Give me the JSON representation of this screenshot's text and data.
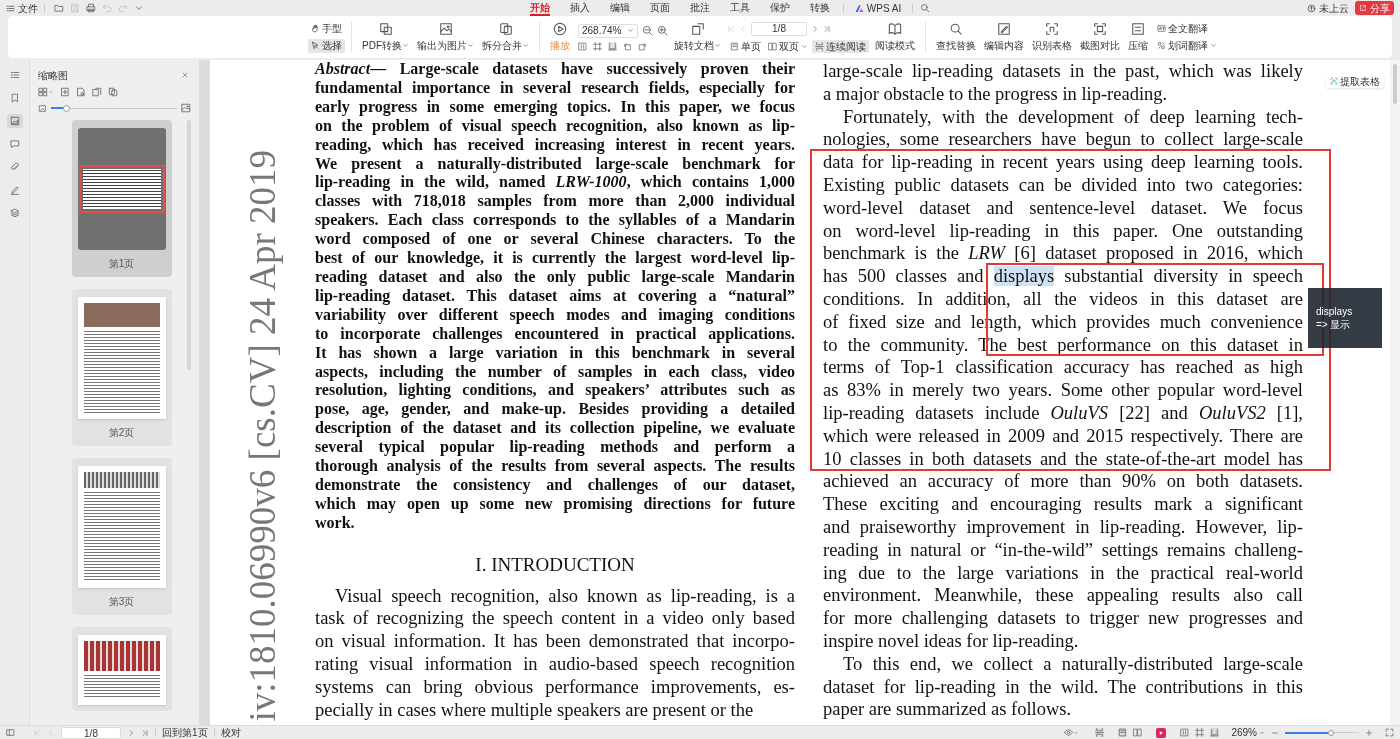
{
  "menu_bar": {
    "file": "文件",
    "tabs": [
      {
        "label": "开始",
        "selected": true
      },
      {
        "label": "插入",
        "selected": false
      },
      {
        "label": "编辑",
        "selected": false
      },
      {
        "label": "页面",
        "selected": false
      },
      {
        "label": "批注",
        "selected": false
      },
      {
        "label": "工具",
        "selected": false
      },
      {
        "label": "保护",
        "selected": false
      },
      {
        "label": "转换",
        "selected": false
      }
    ],
    "ai": "WPS AI",
    "cloud": "未上云",
    "share": "分享"
  },
  "toolbar": {
    "select_tools": [
      {
        "label": "手型",
        "selected": false
      },
      {
        "label": "选择",
        "selected": true
      }
    ],
    "convert": [
      "PDF转换",
      "输出为图片",
      "拆分合并"
    ],
    "play": "播放",
    "zoom": "268.74%",
    "rotate": "旋转文档",
    "page_field": "1/8",
    "view_modes": [
      {
        "label": "单页",
        "selected": false
      },
      {
        "label": "双页",
        "selected": false
      },
      {
        "label": "连续阅读",
        "selected": true
      }
    ],
    "reading_mode": "阅读模式",
    "tools": [
      "查找替换",
      "编辑内容",
      "识别表格",
      "截图对比",
      "压缩"
    ],
    "translate": [
      "全文翻译",
      "划词翻译"
    ]
  },
  "sidebar": {
    "rail": [
      {
        "selected": false
      },
      {
        "selected": false
      },
      {
        "selected": true
      },
      {
        "selected": false
      },
      {
        "selected": false
      },
      {
        "selected": false
      },
      {
        "selected": false
      }
    ],
    "title": "缩略图",
    "thumbnail_size": {
      "level": 0.12
    },
    "thumbnails": [
      {
        "label": "第1页",
        "selected": true
      },
      {
        "label": "第2页",
        "selected": false
      },
      {
        "label": "第3页",
        "selected": false
      },
      {
        "selected": false
      }
    ]
  },
  "document": {
    "stamp": "iv:1810.06990v6  [cs.CV]  24 Apr 2019",
    "abstract": [
      "*Abstract*— Large-scale datasets have successively proven their",
      "fundamental importance in several research fields, especially for",
      "early progress in some emerging topics. In this paper, we focus",
      "on the problem of visual speech recognition, also known as lip-",
      "reading, which has received increasing interest in recent years.",
      "We present a naturally-distributed large-scale benchmark for",
      "lip-reading in the wild, named *LRW-1000*, which contains 1,000",
      "classes with 718,018 samples from more than 2,000 individual",
      "speakers. Each class corresponds to the syllables of a Mandarin",
      "word composed of one or several Chinese characters. To the",
      "best of our knowledge, it is currently the largest word-level lip-",
      "reading dataset and also the only public large-scale Mandarin",
      "lip-reading dataset. This dataset aims at covering a “natural”",
      "variability over different speech modes and imaging conditions",
      "to incorporate challenges encountered in practical applications.",
      "It has shown a large variation in this benchmark in several",
      "aspects, including the number of samples in each class, video",
      "resolution, lighting conditions, and speakers’ attributes such as",
      "pose, age, gender, and make-up. Besides providing a detailed",
      "description of the dataset and its collection pipeline, we evaluate",
      "several typical popular lip-reading methods and perform a",
      "thorough analysis of the results from several aspects. The results",
      "demonstrate the consistency and challenges of our dataset,",
      "which may open up some new promising directions for future",
      "work."
    ],
    "heading": "I. INTRODUCTION",
    "left_paragraphs": [
      {
        "indent": true,
        "lines": [
          "Visual speech recognition, also known as lip-reading, is a",
          "task of recognizing the speech content in a video only based",
          "on visual information. It has been demonstrated that incorpo-",
          "rating visual information in audio-based speech recognition",
          "systems can bring obvious performance improvements, es-",
          "pecially in cases where multiple speakers are present or the"
        ]
      }
    ],
    "right_paragraphs": [
      {
        "indent": false,
        "lines": [
          "large-scale lip-reading datasets in the past, which was likely",
          "a major obstacle to the progress in lip-reading."
        ]
      },
      {
        "indent": true,
        "lines": [
          "Fortunately, with the development of deep learning tech-",
          "nologies, some researchers have begun to collect large-scale",
          "data for lip-reading in recent years using deep learning tools.",
          "Existing public datasets can be divided into two categories:",
          "word-level dataset and sentence-level dataset. We focus",
          "on word-level lip-reading in this paper. One outstanding",
          "benchmark is the *LRW* [6] dataset proposed in 2016, which",
          {
            "before": "has 500 classes and ",
            "highlighted": "displays",
            "after": " substantial diversity in speech"
          },
          "conditions. In addition, all the videos in this dataset are",
          "of fixed size and length, which provides much convenience",
          "to the community. The best performance on this dataset in",
          "terms of Top-1 classification accuracy has reached as high",
          "as 83% in merely two years. Some other popular word-level",
          "lip-reading datasets include *OuluVS* [22] and *OuluVS2* [1],",
          "which were released in 2009 and 2015 respectively. There are",
          "10 classes in both datasets and the state-of-the-art model has",
          "achieved an accuracy of more than 90% on both datasets.",
          "These exciting and encouraging results mark a significant",
          "and praiseworthy improvement in lip-reading. However, lip-",
          "reading in natural or “in-the-wild” settings remains challeng-",
          "ing due to the large variations in the practical real-world",
          "environment. Meanwhile, these appealing results also call",
          "for more challenging datasets to trigger new progresses and",
          "inspire novel ideas for lip-reading."
        ]
      },
      {
        "indent": true,
        "lines": [
          "To this end, we collect a naturally-distributed large-scale",
          "dataset for lip-reading in the wild. The contributions in this",
          "paper are summarized as follows."
        ]
      }
    ],
    "tooltip": {
      "word": "displays",
      "translation": "=> 显示"
    },
    "extract_button": "提取表格"
  },
  "status_bar": {
    "page_field": "1/8",
    "back_to_first": "回到第1页",
    "proofread": "校对",
    "zoom": "269%",
    "zoom_slider": {
      "level": 0.62
    }
  }
}
